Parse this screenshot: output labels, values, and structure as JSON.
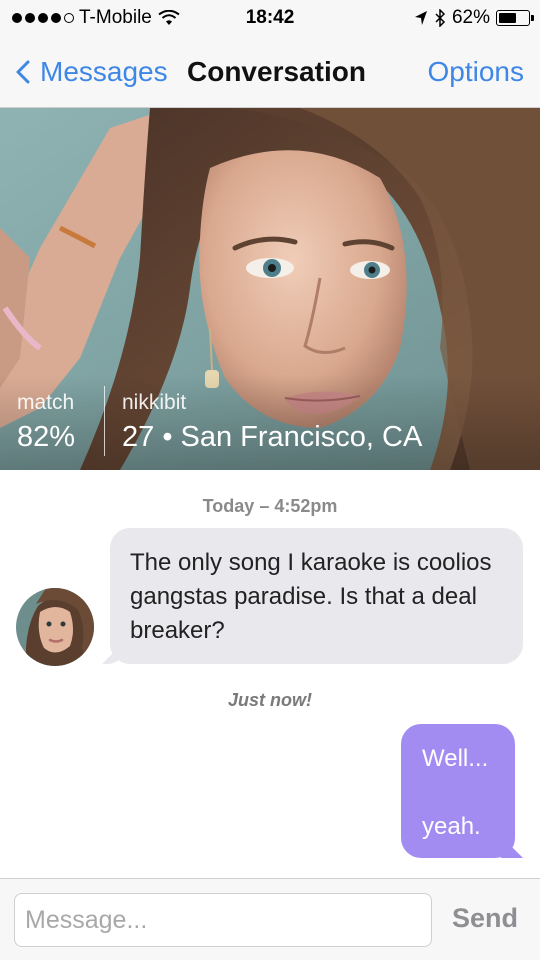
{
  "status_bar": {
    "carrier": "T-Mobile",
    "time": "18:42",
    "battery": "62%",
    "battery_level": 0.62,
    "signal_bars": 4,
    "signal_max": 5
  },
  "nav": {
    "back_label": "Messages",
    "title": "Conversation",
    "options_label": "Options",
    "accent_color": "#3f87e6"
  },
  "profile": {
    "match_label": "match",
    "match_value": "82%",
    "username": "nikkibit",
    "details": "27 • San Francisco, CA"
  },
  "conversation": {
    "today_timestamp": "Today – 4:52pm",
    "received_message": "The only song I karaoke is coolios gangstas paradise. Is that a deal breaker?",
    "now_timestamp": "Just now!",
    "sent_line_1": "Well...",
    "sent_line_2": "yeah.",
    "sent_bubble_color": "#a28cf2",
    "received_bubble_color": "#e9e9ed"
  },
  "composer": {
    "placeholder": "Message...",
    "value": "",
    "send_label": "Send"
  }
}
